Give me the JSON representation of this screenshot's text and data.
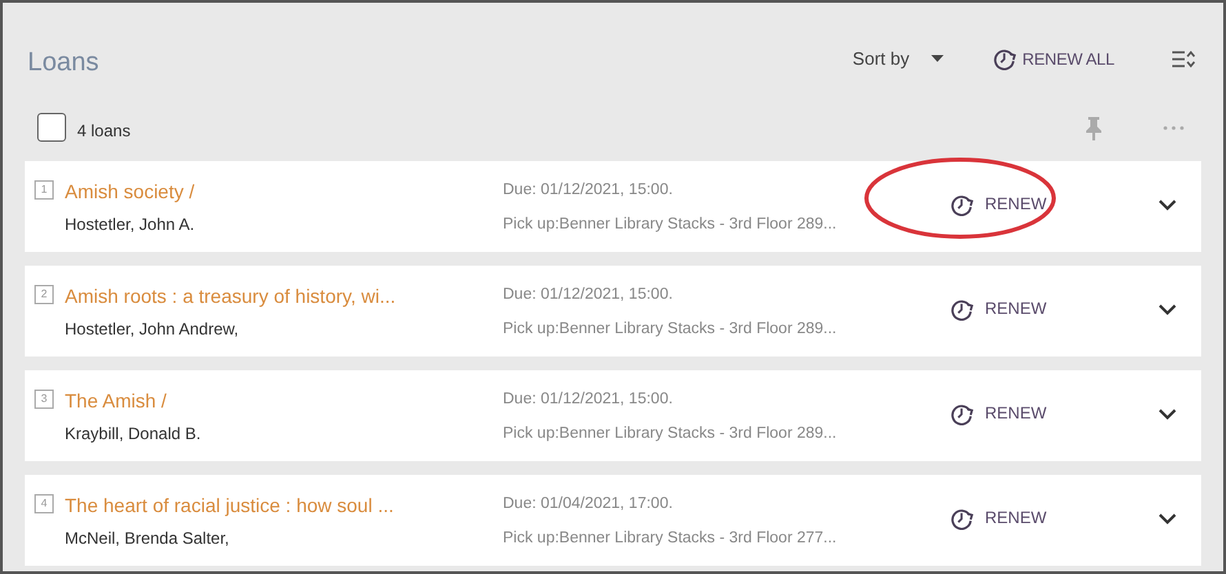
{
  "header": {
    "title": "Loans",
    "sort_label": "Sort by",
    "renew_all": "RENEW ALL"
  },
  "select_all": {
    "label": "4 loans",
    "checked": false
  },
  "loans": [
    {
      "number": "1",
      "title": "Amish society /",
      "author": "Hostetler, John A.",
      "due": "Due: 01/12/2021, 15:00.",
      "pickup": "Pick up:Benner Library Stacks - 3rd Floor 289...",
      "action": "RENEW",
      "highlighted": true
    },
    {
      "number": "2",
      "title": "Amish roots : a treasury of history, wi...",
      "author": "Hostetler, John Andrew,",
      "due": "Due: 01/12/2021, 15:00.",
      "pickup": "Pick up:Benner Library Stacks - 3rd Floor 289...",
      "action": "RENEW",
      "highlighted": false
    },
    {
      "number": "3",
      "title": "The Amish /",
      "author": "Kraybill, Donald B.",
      "due": "Due: 01/12/2021, 15:00.",
      "pickup": "Pick up:Benner Library Stacks - 3rd Floor 289...",
      "action": "RENEW",
      "highlighted": false
    },
    {
      "number": "4",
      "title": "The heart of racial justice : how soul ...",
      "author": "McNeil, Brenda Salter,",
      "due": "Due: 01/04/2021, 17:00.",
      "pickup": "Pick up:Benner Library Stacks - 3rd Floor 277...",
      "action": "RENEW",
      "highlighted": false
    }
  ]
}
